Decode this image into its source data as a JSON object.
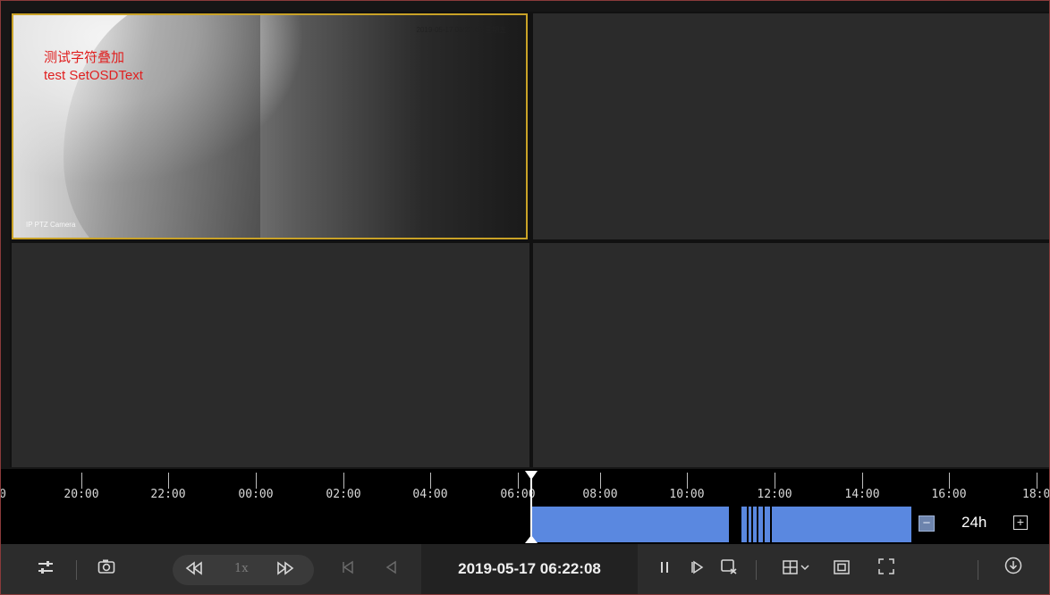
{
  "window": {
    "accent_color": "#c9a227",
    "record_color": "#5a88e0"
  },
  "video_panes": [
    {
      "name": "pane-1",
      "osd_lines": [
        "测试字符叠加",
        "test SetOSDText"
      ],
      "timestamp": "2019-05-17 06:22:08 星期五",
      "camera_name": "IP PTZ Camera",
      "selected": true
    },
    {
      "name": "pane-2"
    },
    {
      "name": "pane-3"
    },
    {
      "name": "pane-4"
    }
  ],
  "timeline": {
    "first_partial_label": "0",
    "labels": [
      "20:00",
      "22:00",
      "00:00",
      "02:00",
      "04:00",
      "06:00",
      "08:00",
      "10:00",
      "12:00",
      "14:00",
      "16:00",
      "18:0"
    ],
    "zoom_label": "24h",
    "zoom_out_icon": "minus-square-icon",
    "zoom_in_icon": "plus-square-icon"
  },
  "toolbar": {
    "settings_icon": "sliders-icon",
    "snapshot_icon": "camera-icon",
    "rewind_icon": "rewind-icon",
    "speed_label": "1x",
    "fast_forward_icon": "fast-forward-icon",
    "prev_frame_icon": "step-back-icon",
    "reverse_icon": "reverse-play-icon",
    "current_time": "2019-05-17 06:22:08",
    "pause_icon": "pause-icon",
    "next_frame_icon": "step-forward-icon",
    "clip_icon": "clip-icon",
    "layout_icon": "layout-grid-icon",
    "window_icon": "window-icon",
    "fullscreen_icon": "fullscreen-icon",
    "download_icon": "download-icon"
  }
}
